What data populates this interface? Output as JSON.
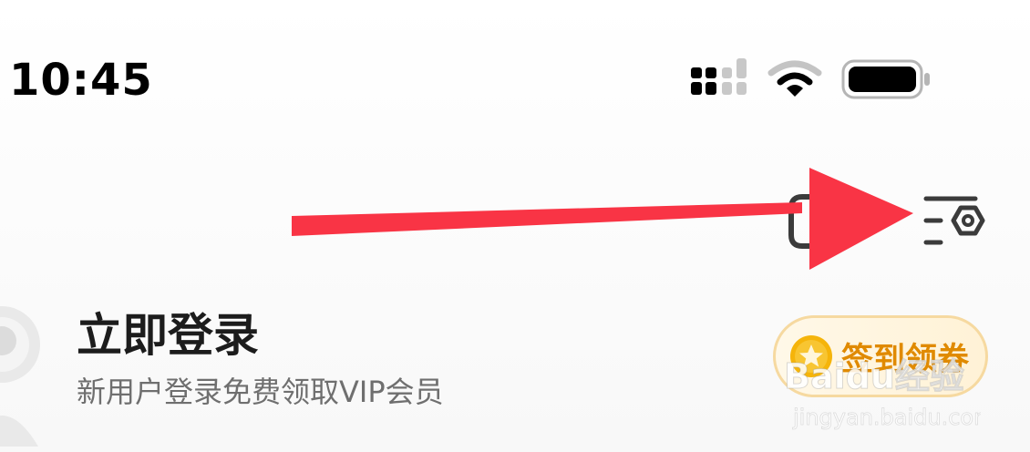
{
  "status_bar": {
    "time": "10:45",
    "icons": [
      "signal-icon",
      "wifi-icon",
      "battery-icon"
    ]
  },
  "toolbar": {
    "icons": [
      "scan-icon",
      "settings-menu-icon"
    ]
  },
  "annotation": {
    "type": "arrow",
    "color": "#f93445",
    "points_to": "settings-menu-icon"
  },
  "profile": {
    "title": "立即登录",
    "subtitle": "新用户登录免费领取VIP会员"
  },
  "checkin": {
    "label": "签到领券",
    "icon": "star-coin-icon"
  },
  "watermark": {
    "brand": "Baidu经验",
    "url": "jingyan.baidu.com"
  },
  "colors": {
    "text_primary": "#1c1c1c",
    "text_secondary": "#6f6f6f",
    "accent_orange": "#e08a00",
    "button_border": "#f6d9a0",
    "coin": "#f5b40a",
    "arrow": "#f93445"
  }
}
